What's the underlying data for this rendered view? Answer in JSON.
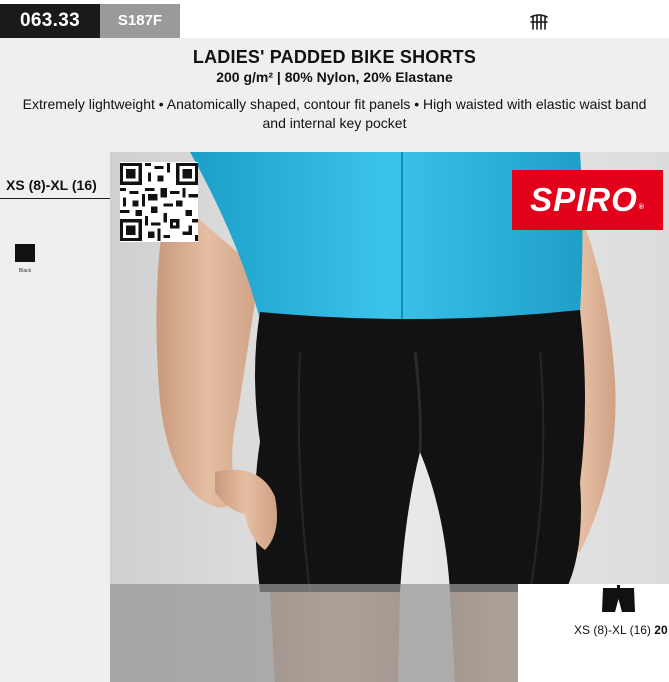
{
  "product": {
    "code": "063.33",
    "ref": "S187F",
    "title": "LADIES' PADDED BIKE SHORTS",
    "subtitle": "200 g/m² | 80% Nylon, 20% Elastane",
    "description": "Extremely lightweight • Anatomically shaped, contour fit panels • High waisted with elastic waist band and internal key pocket"
  },
  "sizes": {
    "label": "XS (8)-XL (16)"
  },
  "colors": [
    {
      "name": "Black",
      "hex": "#111111"
    }
  ],
  "brand": {
    "logo_text": "SPIRO",
    "logo_reg": "®",
    "color": "#e2001a"
  },
  "icons": {
    "care": "care-symbol-icon",
    "garment": "shorts-icon",
    "qr": "qr-code"
  },
  "packaging": {
    "range": "XS (8)-XL (16)",
    "quantity": "20"
  },
  "theme": {
    "header_bg": "#efefef",
    "code_bg": "#1a1a1a",
    "ref_bg": "#9a9a9a",
    "shirt": "#29b5df"
  }
}
